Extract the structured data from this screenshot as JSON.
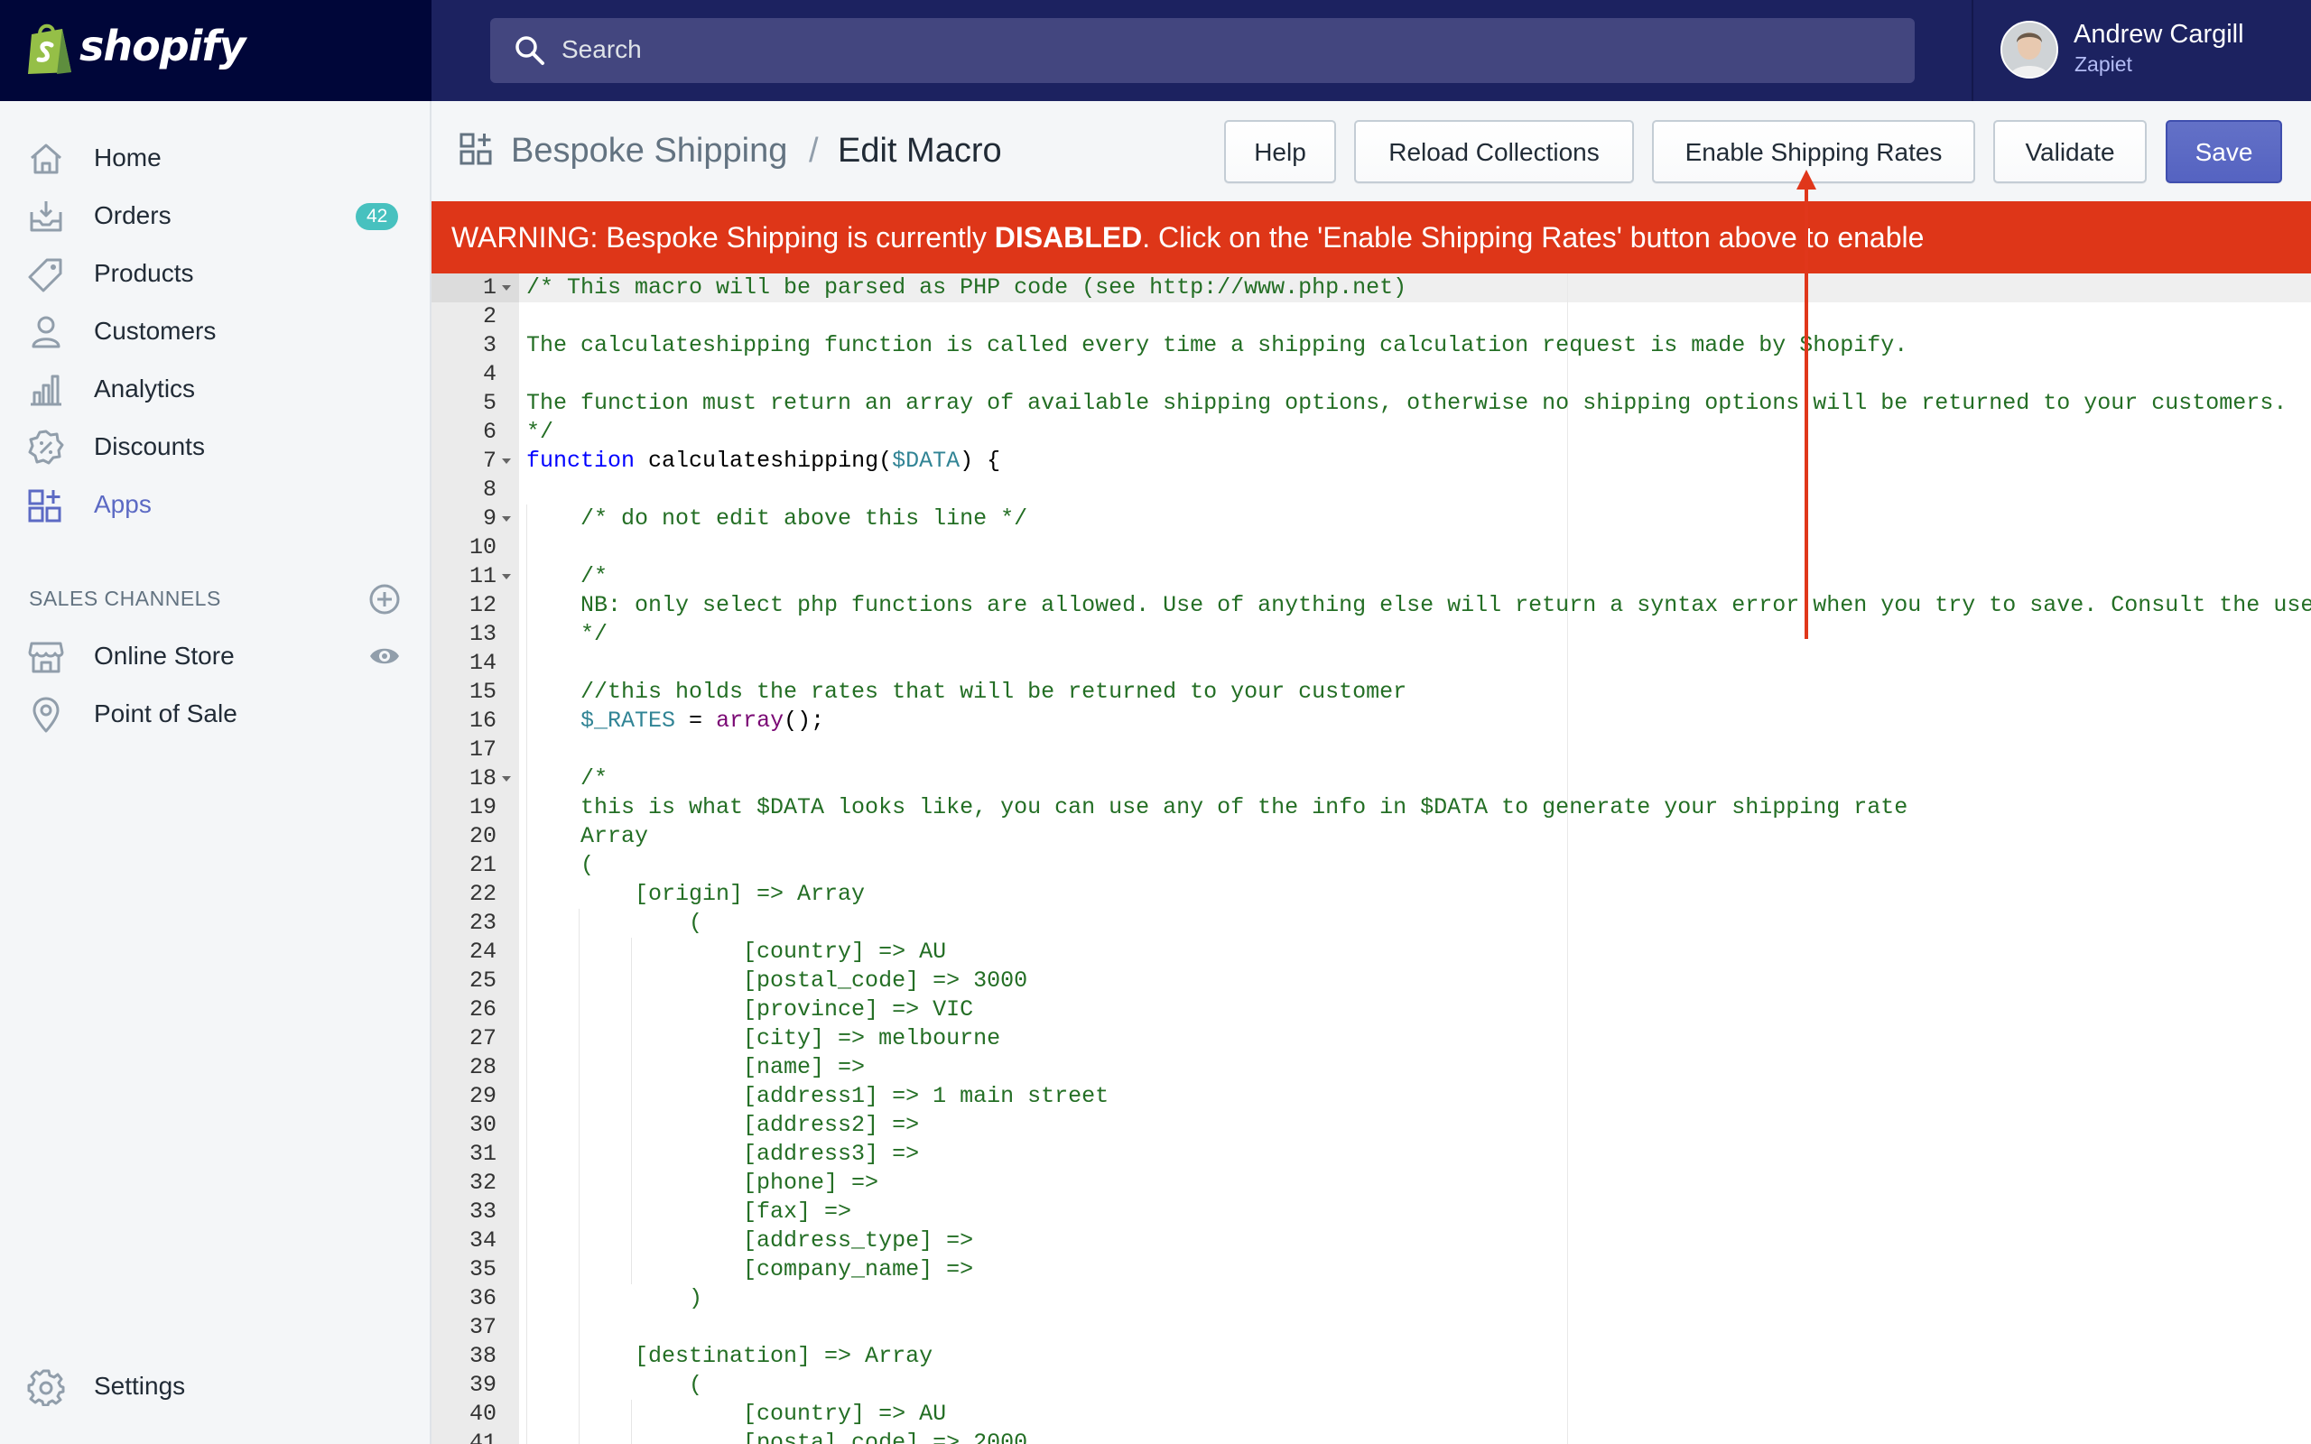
{
  "brand": {
    "logo_text": "shopify",
    "colors": {
      "topbar": "#1c2260",
      "logo_area": "#000639",
      "accent": "#5c6ac4",
      "warning": "#de3618",
      "badge": "#47c1bf"
    }
  },
  "search": {
    "placeholder": "Search"
  },
  "user": {
    "name": "Andrew Cargill",
    "shop": "Zapiet"
  },
  "sidebar": {
    "items": [
      {
        "label": "Home",
        "icon": "home-icon"
      },
      {
        "label": "Orders",
        "icon": "orders-icon",
        "badge": "42"
      },
      {
        "label": "Products",
        "icon": "tag-icon"
      },
      {
        "label": "Customers",
        "icon": "person-icon"
      },
      {
        "label": "Analytics",
        "icon": "bar-chart-icon"
      },
      {
        "label": "Discounts",
        "icon": "discount-icon"
      },
      {
        "label": "Apps",
        "icon": "apps-icon",
        "active": true
      }
    ],
    "sales_channels_label": "SALES CHANNELS",
    "channels": [
      {
        "label": "Online Store",
        "icon": "store-icon"
      },
      {
        "label": "Point of Sale",
        "icon": "location-pin-icon"
      }
    ],
    "settings_label": "Settings"
  },
  "header": {
    "app_name": "Bespoke Shipping",
    "separator": "/",
    "title": "Edit Macro",
    "buttons": {
      "help": "Help",
      "reload": "Reload Collections",
      "enable": "Enable Shipping Rates",
      "validate": "Validate",
      "save": "Save"
    }
  },
  "warning": {
    "prefix": "WARNING: Bespoke Shipping is currently ",
    "strong": "DISABLED",
    "suffix": ". Click on the 'Enable Shipping Rates' button above to enable"
  },
  "editor": {
    "folds": [
      1,
      7,
      9,
      11,
      18
    ],
    "lines": [
      "/* This macro will be parsed as PHP code (see http://www.php.net)",
      "",
      "The calculateshipping function is called every time a shipping calculation request is made by Shopify.",
      "",
      "The function must return an array of available shipping options, otherwise no shipping options will be returned to your customers.",
      "*/",
      "function calculateshipping($DATA) {",
      "",
      "    /* do not edit above this line */",
      "",
      "    /*",
      "    NB: only select php functions are allowed. Use of anything else will return a syntax error when you try to save. Consult the user guide",
      "    */",
      "",
      "    //this holds the rates that will be returned to your customer",
      "    $_RATES = array();",
      "",
      "    /*",
      "    this is what $DATA looks like, you can use any of the info in $DATA to generate your shipping rate",
      "    Array",
      "    (",
      "        [origin] => Array",
      "            (",
      "                [country] => AU",
      "                [postal_code] => 3000",
      "                [province] => VIC",
      "                [city] => melbourne",
      "                [name] =>",
      "                [address1] => 1 main street",
      "                [address2] =>",
      "                [address3] =>",
      "                [phone] =>",
      "                [fax] =>",
      "                [address_type] =>",
      "                [company_name] =>",
      "            )",
      "",
      "        [destination] => Array",
      "            (",
      "                [country] => AU",
      "                [postal_code] => 2000"
    ]
  }
}
